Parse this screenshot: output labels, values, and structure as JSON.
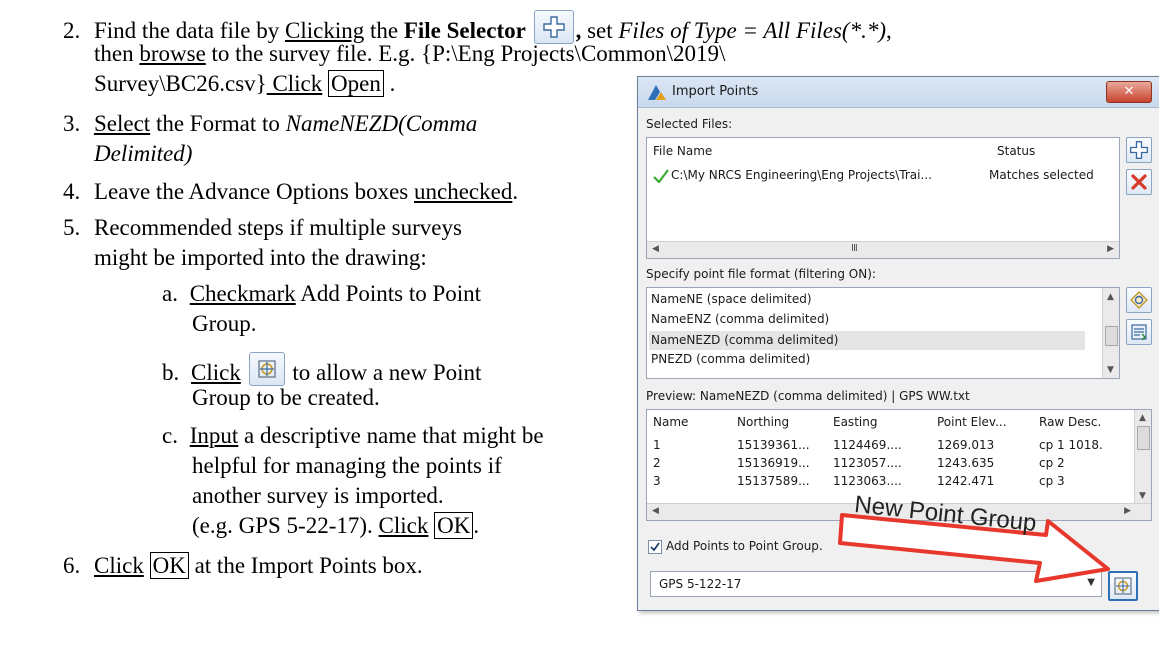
{
  "doc": {
    "step2": {
      "num": "2.",
      "t1": "Find the data file by ",
      "t2": "Clicking",
      "t3": " the ",
      "t4": "File Selector",
      "t5": ",",
      "t6": " set ",
      "t7": "Files of Type = All Files(*.*)",
      "t8": ",",
      "line2a": "then ",
      "line2b": "browse",
      "line2c": " to the survey file. E.g. {P:\\Eng Projects\\Common\\2019\\",
      "line3a": "Survey\\BC26.csv}",
      "line3b": " Click",
      "line3c": " ",
      "line3d": "Open",
      "line3e": " ."
    },
    "step3": {
      "num": "3.",
      "t1": "Select",
      "t2": " the Format to ",
      "t3": "NameNEZD(Comma",
      "line2": "Delimited)"
    },
    "step4": {
      "num": "4.",
      "t1": "Leave the Advance Options boxes ",
      "t2": "unchecked",
      "t3": "."
    },
    "step5": {
      "num": "5.",
      "line1": "Recommended steps if multiple surveys",
      "line2": "might be imported into the drawing:",
      "a": {
        "num": "a.",
        "t1": "Checkmark",
        "t2": " Add Points to Point",
        "line2": "Group."
      },
      "b": {
        "num": "b.",
        "t1": "Click",
        "t2": " to allow a new Point",
        "line2": "Group to be created."
      },
      "c": {
        "num": "c.",
        "t1": "Input",
        "t2": " a descriptive name that might be",
        "line2": "helpful for managing the points if",
        "line3": "another survey is imported.",
        "line4a": "(e.g. GPS 5-22-17). ",
        "line4b": "Click",
        "line4c": " ",
        "line4d": "OK",
        "line4e": "."
      }
    },
    "step6": {
      "num": "6.",
      "t1": "Click",
      "t2": " ",
      "t3": "OK",
      "t4": " at the Import Points box."
    }
  },
  "dialog": {
    "title": "Import Points",
    "close_label": "✕",
    "selected_files_label": "Selected Files:",
    "file_col_name": "File Name",
    "file_col_status": "Status",
    "file_row_name": "C:\\My NRCS Engineering\\Eng Projects\\Trai...",
    "file_row_status": "Matches selected",
    "hscroll_mark": "III",
    "format_label": "Specify point file format (filtering ON):",
    "formats": [
      "NameNE (space delimited)",
      "NameENZ (comma delimited)",
      "NameNEZD (comma delimited)",
      "PNEZD (comma delimited)"
    ],
    "preview_label": "Preview: NameNEZD (comma delimited) | GPS WW.txt",
    "preview_headers": [
      "Name",
      "Northing",
      "Easting",
      "Point Elev...",
      "Raw Desc."
    ],
    "preview_rows": [
      [
        "1",
        "15139361...",
        "1124469....",
        "1269.013",
        "cp 1 1018."
      ],
      [
        "2",
        "15136919...",
        "1123057....",
        "1243.635",
        "cp 2"
      ],
      [
        "3",
        "15137589...",
        "1123063....",
        "1242.471",
        "cp 3"
      ]
    ],
    "add_to_group_label": "Add Points to Point Group.",
    "group_value": "GPS 5-122-17",
    "callout": "New Point Group"
  },
  "colors": {
    "accent_blue": "#2f6fb5",
    "arrow_red": "#e8382d",
    "close_red": "#c7432d",
    "check_green": "#3aa935"
  }
}
